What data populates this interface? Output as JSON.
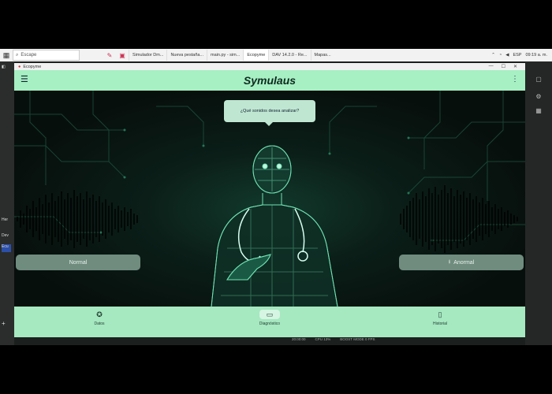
{
  "taskbar": {
    "search_placeholder": "Escape",
    "tabs": [
      {
        "label": "Simulador Dm...",
        "active": false
      },
      {
        "label": "Nueva pestaña...",
        "active": false
      },
      {
        "label": "main.py - sim...",
        "active": false
      },
      {
        "label": "Ecopyme",
        "active": true
      },
      {
        "label": "DAV 14.2.0 - Re...",
        "active": false
      },
      {
        "label": "Mapas...",
        "active": false
      }
    ],
    "tray_lang": "ESP",
    "tray_time": "09:19 a. m."
  },
  "left_strip": [
    "Her",
    "Dev",
    "Ecu"
  ],
  "window": {
    "title": "Ecopyme",
    "controls": {
      "minimize": "—",
      "maximize": "☐",
      "close": "✕"
    }
  },
  "appbar": {
    "title": "Symulaus"
  },
  "bubble": {
    "text": "¿Qué sonidos desea analizar?"
  },
  "buttons": {
    "left": "Normal",
    "right": "Anormal"
  },
  "bottom_nav": [
    {
      "label": "Datos",
      "icon": "compass-icon",
      "active": false
    },
    {
      "label": "Diagnóstico",
      "icon": "chat-icon",
      "active": true
    },
    {
      "label": "Historial",
      "icon": "bookmark-icon",
      "active": false
    }
  ],
  "status": [
    "20:00:00",
    "CPU 13%",
    "BOOST MODE 0 FPS"
  ],
  "colors": {
    "accent": "#a6f0c3",
    "nav_bar": "#a6e8c0",
    "pill": "#6f8c7f",
    "bubble": "#bfe6d1",
    "figure": "#6fe3b4"
  }
}
